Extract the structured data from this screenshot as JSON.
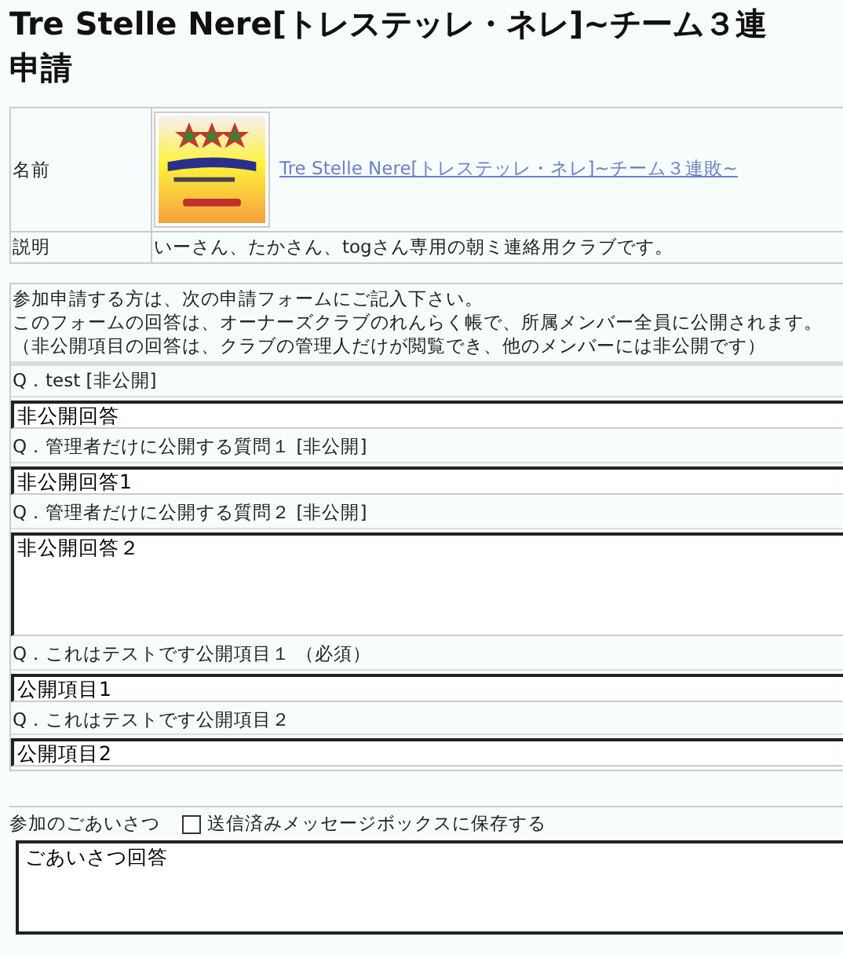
{
  "title_lines": [
    "Tre Stelle Nere[トレステッレ・ネレ]~チーム３連",
    "申請"
  ],
  "club_info": [
    {
      "label": "名前",
      "kind": "logo_link",
      "link": "Tre Stelle Nere[トレステッレ・ネレ]~チーム３連敗~"
    },
    {
      "label": "説明",
      "kind": "text",
      "value": "いーさん、たかさん、togさん専用の朝ミ連絡用クラブです。"
    }
  ],
  "intro": [
    "参加申請する方は、次の申請フォームにご記入下さい。",
    "このフォームの回答は、オーナーズクラブのれんらく帳で、所属メンバー全員に公開されます。",
    "（非公開項目の回答は、クラブの管理人だけが閲覧でき、他のメンバーには非公開です）"
  ],
  "questions": [
    {
      "label": "Q．test [非公開]",
      "kind": "input",
      "value": "非公開回答"
    },
    {
      "label": "Q．管理者だけに公開する質問１ [非公開]",
      "kind": "input",
      "value": "非公開回答1"
    },
    {
      "label": "Q．管理者だけに公開する質問２ [非公開]",
      "kind": "textarea",
      "value": "非公開回答２"
    },
    {
      "label": "Q．これはテストです公開項目１ （必須）",
      "kind": "input",
      "value": "公開項目1"
    },
    {
      "label": "Q．これはテストです公開項目２",
      "kind": "input",
      "value": "公開項目2"
    }
  ],
  "greeting": {
    "label": "参加のごあいさつ",
    "save_checkbox": {
      "label": "送信済みメッセージボックスに保存する",
      "checked": false
    },
    "value": "ごあいさつ回答"
  }
}
